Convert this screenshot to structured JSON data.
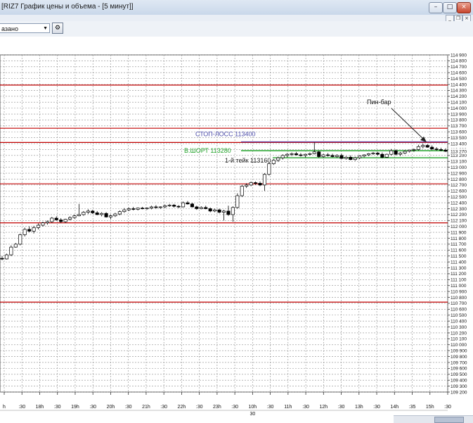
{
  "window": {
    "title": "[RIZ7 График цены и объема - [5 минут]]",
    "min_glyph": "–",
    "max_glyph": "□",
    "close_glyph": "×",
    "mdi_min": "_",
    "mdi_restore": "❐",
    "mdi_close": "×"
  },
  "toolbar": {
    "instrument": "азано",
    "dropdown_glyph": "▼",
    "settings_icon": "settings-icon"
  },
  "chart_data": {
    "type": "candlestick",
    "title": "",
    "ylim": [
      109200,
      114900
    ],
    "y_tick_step": 100,
    "grid": true,
    "colors": {
      "grid": "#8c8c8c",
      "red_level": "#c00000",
      "purple_level": "#6a3d9a",
      "green_level": "#22a22a",
      "price_marker": "#e04040",
      "candle": "#000000"
    },
    "x_labels": [
      "h",
      ":30",
      "18h",
      ":30",
      "19h",
      ":30",
      "20h",
      ":30",
      "21h",
      ":30",
      "22h",
      ":30",
      "23h",
      ":30",
      "10h",
      ":30",
      "11h",
      ":30",
      "12h",
      ":30",
      "13h",
      ":30",
      "14h",
      ":35",
      "15h",
      ":30"
    ],
    "date_label": "30",
    "horizontal_levels": [
      {
        "value": 114390,
        "kind": "resistance"
      },
      {
        "value": 113660,
        "kind": "resistance"
      },
      {
        "value": 113420,
        "kind": "resistance"
      },
      {
        "value": 112720,
        "kind": "support"
      },
      {
        "value": 112060,
        "kind": "support"
      },
      {
        "value": 110720,
        "kind": "support"
      }
    ],
    "trade_levels": [
      {
        "name": "stop",
        "label": "СТОП-ЛОСС 113400",
        "value": 113430
      },
      {
        "name": "entry",
        "label": "В.ШОРТ 113280",
        "value": 113280
      },
      {
        "name": "take",
        "label": "1-й тейк 113160",
        "value": 113160
      }
    ],
    "annotation": {
      "label": "Пин-бар"
    },
    "last_price": "113 270",
    "candles": [
      [
        111460,
        111500,
        111430,
        111450
      ],
      [
        111450,
        111540,
        111440,
        111520
      ],
      [
        111520,
        111680,
        111500,
        111650
      ],
      [
        111650,
        111720,
        111640,
        111700
      ],
      [
        111700,
        111880,
        111680,
        111860
      ],
      [
        111860,
        111980,
        111830,
        111950
      ],
      [
        111950,
        112000,
        111900,
        111920
      ],
      [
        111920,
        112010,
        111880,
        111980
      ],
      [
        111980,
        112050,
        111950,
        112020
      ],
      [
        112020,
        112080,
        112000,
        112060
      ],
      [
        112060,
        112100,
        112030,
        112080
      ],
      [
        112080,
        112160,
        112060,
        112140
      ],
      [
        112140,
        112170,
        112100,
        112110
      ],
      [
        112110,
        112140,
        112060,
        112080
      ],
      [
        112080,
        112130,
        112060,
        112120
      ],
      [
        112120,
        112170,
        112100,
        112150
      ],
      [
        112150,
        112200,
        112130,
        112180
      ],
      [
        112180,
        112380,
        112170,
        112200
      ],
      [
        112200,
        112260,
        112180,
        112240
      ],
      [
        112240,
        112290,
        112210,
        112260
      ],
      [
        112260,
        112280,
        112210,
        112230
      ],
      [
        112230,
        112260,
        112190,
        112200
      ],
      [
        112200,
        112240,
        112170,
        112220
      ],
      [
        112220,
        112240,
        112150,
        112160
      ],
      [
        112160,
        112200,
        112120,
        112180
      ],
      [
        112180,
        112230,
        112160,
        112210
      ],
      [
        112210,
        112270,
        112190,
        112250
      ],
      [
        112250,
        112310,
        112230,
        112280
      ],
      [
        112280,
        112320,
        112260,
        112300
      ],
      [
        112300,
        112330,
        112270,
        112290
      ],
      [
        112290,
        112320,
        112270,
        112310
      ],
      [
        112310,
        112330,
        112290,
        112300
      ],
      [
        112300,
        112320,
        112280,
        112310
      ],
      [
        112310,
        112350,
        112290,
        112330
      ],
      [
        112330,
        112360,
        112300,
        112320
      ],
      [
        112320,
        112340,
        112300,
        112330
      ],
      [
        112330,
        112370,
        112310,
        112350
      ],
      [
        112350,
        112380,
        112330,
        112360
      ],
      [
        112360,
        112380,
        112320,
        112340
      ],
      [
        112340,
        112360,
        112310,
        112330
      ],
      [
        112330,
        112420,
        112320,
        112400
      ],
      [
        112400,
        112430,
        112370,
        112380
      ],
      [
        112380,
        112400,
        112320,
        112330
      ],
      [
        112330,
        112350,
        112280,
        112300
      ],
      [
        112300,
        112340,
        112290,
        112320
      ],
      [
        112320,
        112350,
        112290,
        112300
      ],
      [
        112300,
        112320,
        112240,
        112260
      ],
      [
        112260,
        112300,
        112240,
        112280
      ],
      [
        112280,
        112300,
        112220,
        112240
      ],
      [
        112240,
        112280,
        112100,
        112260
      ],
      [
        112260,
        112350,
        112180,
        112200
      ],
      [
        112200,
        112340,
        112080,
        112320
      ],
      [
        112320,
        112560,
        112300,
        112520
      ],
      [
        112520,
        112700,
        112500,
        112680
      ],
      [
        112680,
        112730,
        112650,
        112700
      ],
      [
        112700,
        112760,
        112680,
        112740
      ],
      [
        112740,
        112760,
        112700,
        112730
      ],
      [
        112730,
        112760,
        112680,
        112700
      ],
      [
        112700,
        112900,
        112600,
        112880
      ],
      [
        112880,
        113080,
        112860,
        113060
      ],
      [
        113060,
        113140,
        113040,
        113120
      ],
      [
        113120,
        113180,
        113090,
        113160
      ],
      [
        113160,
        113220,
        113130,
        113200
      ],
      [
        113200,
        113240,
        113170,
        113220
      ],
      [
        113220,
        113250,
        113190,
        113230
      ],
      [
        113230,
        113260,
        113200,
        113210
      ],
      [
        113210,
        113240,
        113180,
        113200
      ],
      [
        113200,
        113230,
        113170,
        113220
      ],
      [
        113220,
        113250,
        113200,
        113230
      ],
      [
        113230,
        113420,
        113220,
        113260
      ],
      [
        113260,
        113280,
        113160,
        113180
      ],
      [
        113180,
        113230,
        113160,
        113210
      ],
      [
        113210,
        113240,
        113180,
        113200
      ],
      [
        113200,
        113230,
        113170,
        113180
      ],
      [
        113180,
        113220,
        113160,
        113200
      ],
      [
        113200,
        113230,
        113140,
        113150
      ],
      [
        113150,
        113190,
        113130,
        113170
      ],
      [
        113170,
        113200,
        113120,
        113130
      ],
      [
        113130,
        113180,
        113110,
        113160
      ],
      [
        113160,
        113200,
        113140,
        113190
      ],
      [
        113190,
        113220,
        113170,
        113210
      ],
      [
        113210,
        113240,
        113190,
        113230
      ],
      [
        113230,
        113260,
        113210,
        113240
      ],
      [
        113240,
        113260,
        113200,
        113220
      ],
      [
        113220,
        113250,
        113150,
        113170
      ],
      [
        113170,
        113230,
        113160,
        113220
      ],
      [
        113220,
        113310,
        113200,
        113280
      ],
      [
        113280,
        113300,
        113200,
        113220
      ],
      [
        113220,
        113260,
        113190,
        113240
      ],
      [
        113240,
        113290,
        113220,
        113270
      ],
      [
        113270,
        113300,
        113250,
        113290
      ],
      [
        113290,
        113320,
        113260,
        113300
      ],
      [
        113300,
        113380,
        113280,
        113350
      ],
      [
        113350,
        113400,
        113320,
        113370
      ],
      [
        113370,
        113390,
        113330,
        113340
      ],
      [
        113340,
        113370,
        113290,
        113310
      ],
      [
        113310,
        113340,
        113280,
        113300
      ],
      [
        113300,
        113330,
        113270,
        113290
      ],
      [
        113290,
        113320,
        113260,
        113270
      ]
    ]
  }
}
